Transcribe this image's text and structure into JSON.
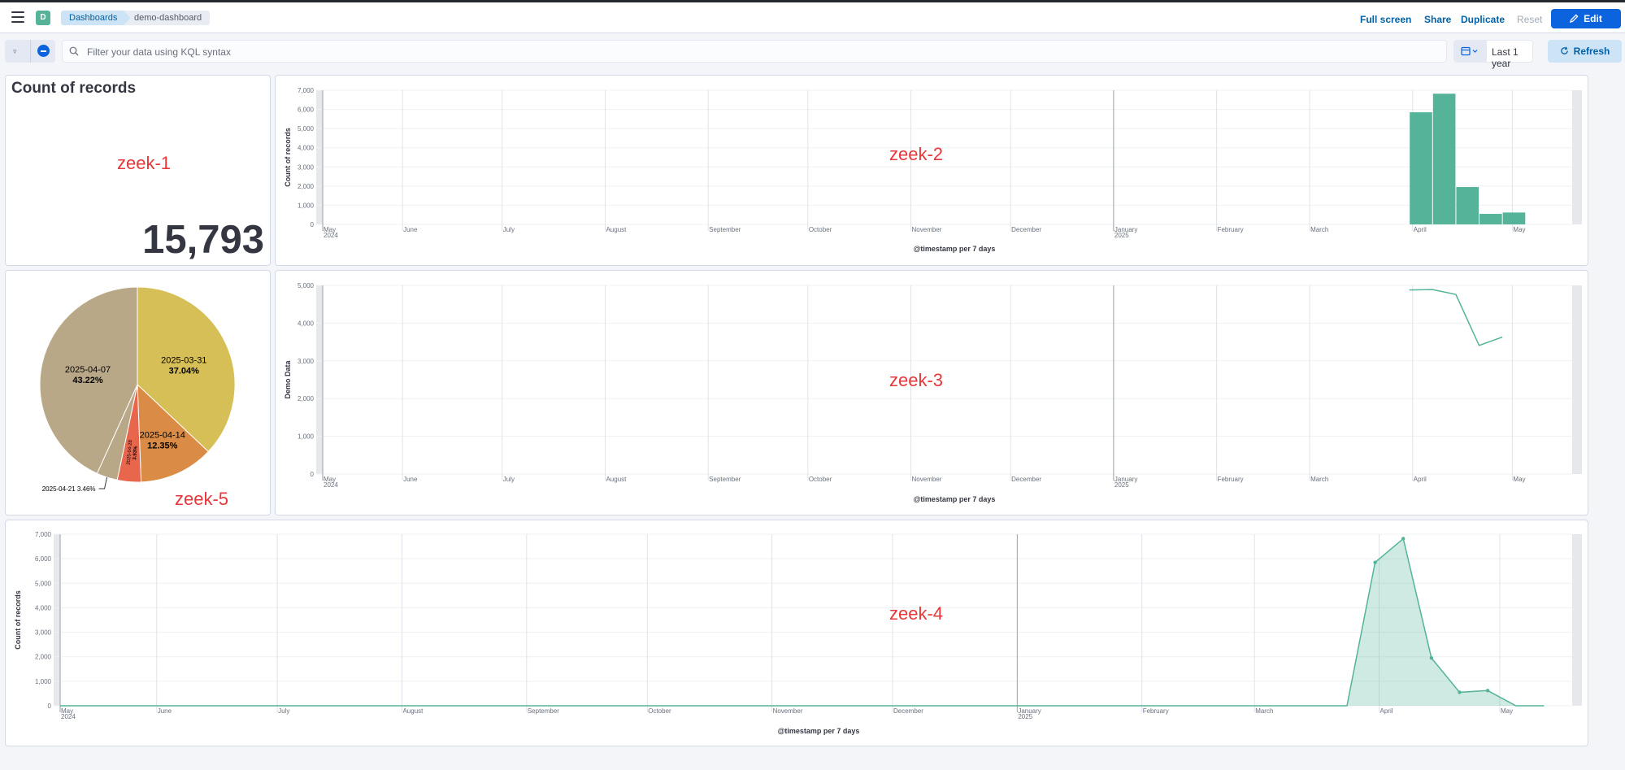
{
  "header": {
    "space_initial": "D",
    "breadcrumbs": [
      "Dashboards",
      "demo-dashboard"
    ],
    "actions": {
      "full_screen": "Full screen",
      "share": "Share",
      "duplicate": "Duplicate",
      "reset": "Reset",
      "edit": "Edit"
    }
  },
  "query": {
    "placeholder": "Filter your data using KQL syntax",
    "time_range": "Last 1 year",
    "refresh": "Refresh"
  },
  "panels": {
    "zeek1": {
      "overlay_label": "zeek-1",
      "title": "Count of records",
      "value": "15,793"
    },
    "zeek2": {
      "overlay_label": "zeek-2"
    },
    "zeek3": {
      "overlay_label": "zeek-3"
    },
    "zeek4": {
      "overlay_label": "zeek-4"
    },
    "zeek5": {
      "overlay_label": "zeek-5"
    }
  },
  "colors": {
    "accent": "#0b64dd",
    "series": "#54b399",
    "overlay_label": "#e7373a"
  },
  "chart_data": [
    {
      "id": "zeek-2",
      "type": "bar",
      "ylabel": "Count of records",
      "xlabel": "@timestamp per 7 days",
      "ylim": [
        0,
        7000
      ],
      "yticks": [
        0,
        1000,
        2000,
        3000,
        4000,
        5000,
        6000,
        7000
      ],
      "x_domain": [
        "2024-05-08",
        "2025-05-19"
      ],
      "month_ticks": [
        {
          "date": "2024-05-08",
          "label": "May",
          "sub": "2024"
        },
        {
          "date": "2024-06-01",
          "label": "June"
        },
        {
          "date": "2024-07-01",
          "label": "July"
        },
        {
          "date": "2024-08-01",
          "label": "August"
        },
        {
          "date": "2024-09-01",
          "label": "September"
        },
        {
          "date": "2024-10-01",
          "label": "October"
        },
        {
          "date": "2024-11-01",
          "label": "November"
        },
        {
          "date": "2024-12-01",
          "label": "December"
        },
        {
          "date": "2025-01-01",
          "label": "January",
          "sub": "2025"
        },
        {
          "date": "2025-02-01",
          "label": "February"
        },
        {
          "date": "2025-03-01",
          "label": "March"
        },
        {
          "date": "2025-04-01",
          "label": "April"
        },
        {
          "date": "2025-05-01",
          "label": "May"
        }
      ],
      "x": [
        "2025-03-31",
        "2025-04-07",
        "2025-04-14",
        "2025-04-21",
        "2025-04-28"
      ],
      "values": [
        5850,
        6820,
        1950,
        550,
        620
      ]
    },
    {
      "id": "zeek-3",
      "type": "line",
      "ylabel": "Demo Data",
      "xlabel": "@timestamp per 7 days",
      "ylim": [
        0,
        5000
      ],
      "yticks": [
        0,
        1000,
        2000,
        3000,
        4000,
        5000
      ],
      "x_domain": [
        "2024-05-08",
        "2025-05-19"
      ],
      "month_ticks": [
        {
          "date": "2024-05-08",
          "label": "May",
          "sub": "2024"
        },
        {
          "date": "2024-06-01",
          "label": "June"
        },
        {
          "date": "2024-07-01",
          "label": "July"
        },
        {
          "date": "2024-08-01",
          "label": "August"
        },
        {
          "date": "2024-09-01",
          "label": "September"
        },
        {
          "date": "2024-10-01",
          "label": "October"
        },
        {
          "date": "2024-11-01",
          "label": "November"
        },
        {
          "date": "2024-12-01",
          "label": "December"
        },
        {
          "date": "2025-01-01",
          "label": "January",
          "sub": "2025"
        },
        {
          "date": "2025-02-01",
          "label": "February"
        },
        {
          "date": "2025-03-01",
          "label": "March"
        },
        {
          "date": "2025-04-01",
          "label": "April"
        },
        {
          "date": "2025-05-01",
          "label": "May"
        }
      ],
      "x": [
        "2025-03-31",
        "2025-04-07",
        "2025-04-14",
        "2025-04-21",
        "2025-04-28"
      ],
      "values": [
        4880,
        4890,
        4760,
        3410,
        3630
      ]
    },
    {
      "id": "zeek-4",
      "type": "area",
      "ylabel": "Count of records",
      "xlabel": "@timestamp per 7 days",
      "ylim": [
        0,
        7000
      ],
      "yticks": [
        0,
        1000,
        2000,
        3000,
        4000,
        5000,
        6000,
        7000
      ],
      "x_domain": [
        "2024-05-08",
        "2025-05-19"
      ],
      "month_ticks": [
        {
          "date": "2024-05-08",
          "label": "May",
          "sub": "2024"
        },
        {
          "date": "2024-06-01",
          "label": "June"
        },
        {
          "date": "2024-07-01",
          "label": "July"
        },
        {
          "date": "2024-08-01",
          "label": "August"
        },
        {
          "date": "2024-09-01",
          "label": "September"
        },
        {
          "date": "2024-10-01",
          "label": "October"
        },
        {
          "date": "2024-11-01",
          "label": "November"
        },
        {
          "date": "2024-12-01",
          "label": "December"
        },
        {
          "date": "2025-01-01",
          "label": "January",
          "sub": "2025"
        },
        {
          "date": "2025-02-01",
          "label": "February"
        },
        {
          "date": "2025-03-01",
          "label": "March"
        },
        {
          "date": "2025-04-01",
          "label": "April"
        },
        {
          "date": "2025-05-01",
          "label": "May"
        }
      ],
      "x": [
        "2024-05-08",
        "2025-03-24",
        "2025-03-31",
        "2025-04-07",
        "2025-04-14",
        "2025-04-21",
        "2025-04-28",
        "2025-05-05",
        "2025-05-12"
      ],
      "values": [
        0,
        0,
        5850,
        6820,
        1950,
        550,
        620,
        0,
        0
      ],
      "markers": [
        false,
        false,
        true,
        true,
        true,
        true,
        true,
        false,
        false
      ]
    },
    {
      "id": "zeek-5",
      "type": "pie",
      "slices": [
        {
          "label": "2025-03-31",
          "percent": "37.04%",
          "value": 37.04,
          "color": "#d6bf57"
        },
        {
          "label": "2025-04-14",
          "percent": "12.35%",
          "value": 12.35,
          "color": "#da8b45"
        },
        {
          "label": "2025-04-28",
          "percent": "3.93%",
          "value": 3.93,
          "color": "#e7664c"
        },
        {
          "label": "2025-04-21",
          "percent": "3.46%",
          "value": 3.46,
          "color": "#b9a888"
        },
        {
          "label": "2025-04-07",
          "percent": "43.22%",
          "value": 43.22,
          "color": "#b9a888"
        }
      ]
    }
  ]
}
